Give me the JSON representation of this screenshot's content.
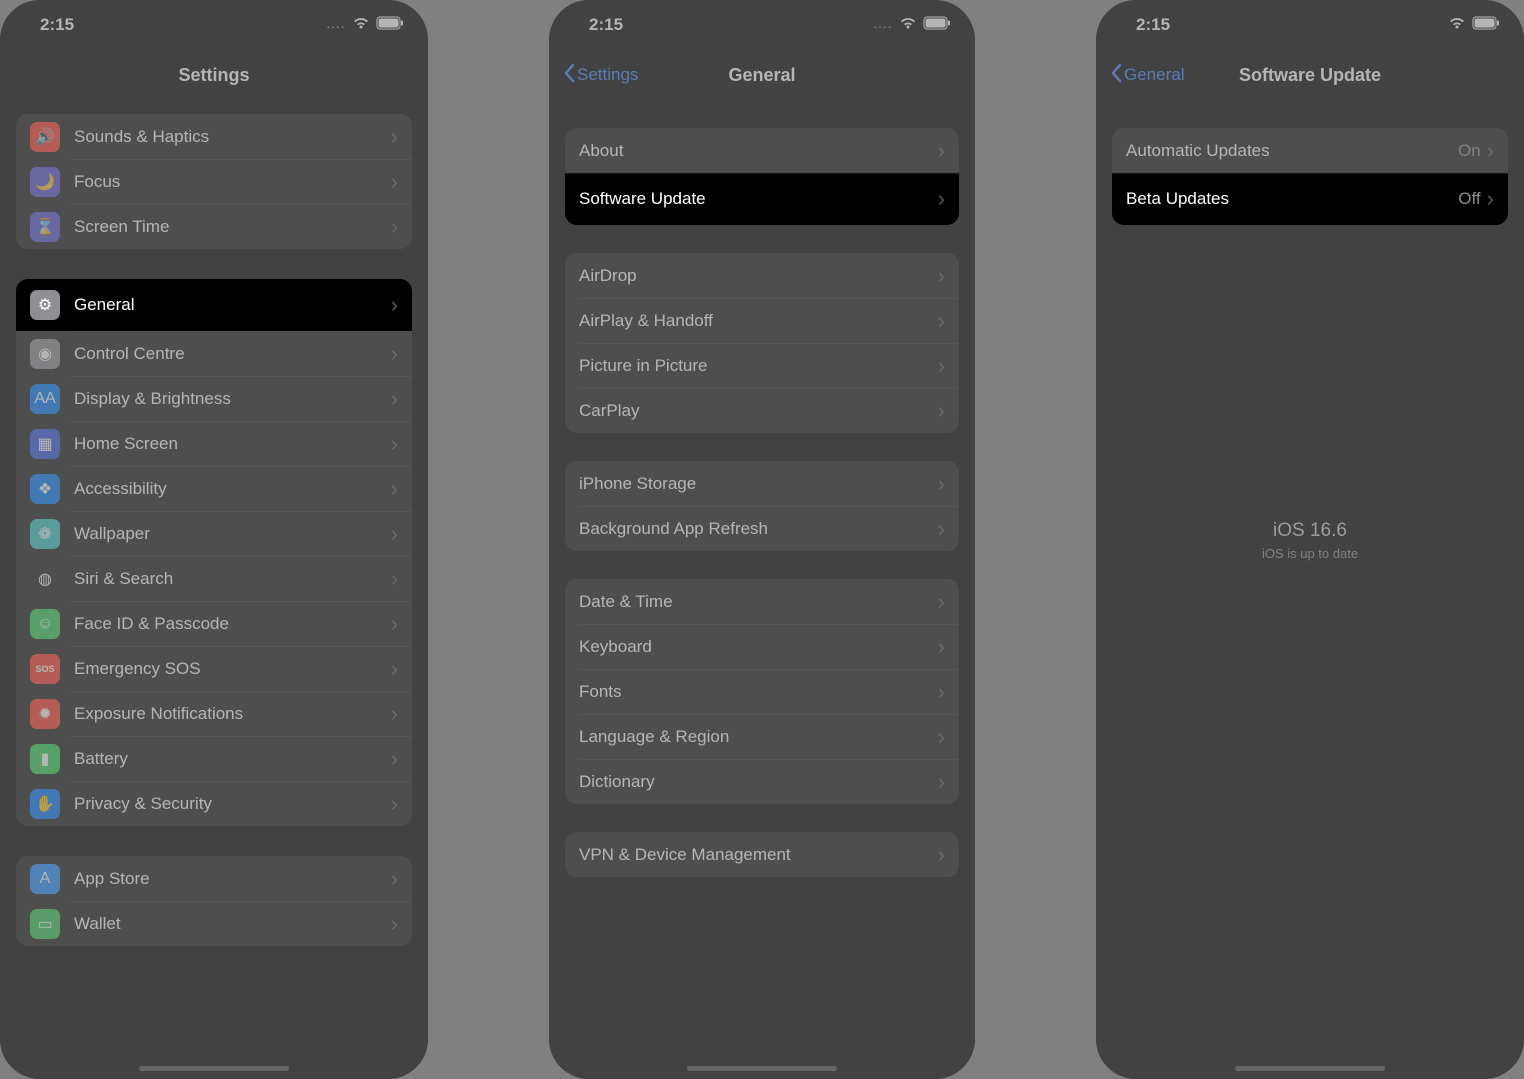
{
  "status": {
    "time": "2:15",
    "dots": "...."
  },
  "screen1": {
    "title": "Settings",
    "group1": [
      {
        "icon": "sounds-icon",
        "bg": "#ff3b30",
        "glyph": "🔊",
        "label": "Sounds & Haptics"
      },
      {
        "icon": "focus-icon",
        "bg": "#5856d6",
        "glyph": "🌙",
        "label": "Focus"
      },
      {
        "icon": "screentime-icon",
        "bg": "#5856d6",
        "glyph": "⌛",
        "label": "Screen Time"
      }
    ],
    "group2": [
      {
        "icon": "general-icon",
        "bg": "#8e8e93",
        "glyph": "⚙",
        "label": "General",
        "hl": true
      },
      {
        "icon": "control-centre-icon",
        "bg": "#8e8e93",
        "glyph": "◉",
        "label": "Control Centre"
      },
      {
        "icon": "display-icon",
        "bg": "#007aff",
        "glyph": "AA",
        "label": "Display & Brightness"
      },
      {
        "icon": "home-screen-icon",
        "bg": "#3355dd",
        "glyph": "▦",
        "label": "Home Screen"
      },
      {
        "icon": "accessibility-icon",
        "bg": "#007aff",
        "glyph": "❖",
        "label": "Accessibility"
      },
      {
        "icon": "wallpaper-icon",
        "bg": "#34c7c2",
        "glyph": "❁",
        "label": "Wallpaper"
      },
      {
        "icon": "siri-icon",
        "bg": "#1c1c1e",
        "glyph": "◍",
        "label": "Siri & Search"
      },
      {
        "icon": "faceid-icon",
        "bg": "#30d158",
        "glyph": "☺",
        "label": "Face ID & Passcode"
      },
      {
        "icon": "sos-icon",
        "bg": "#ff3b30",
        "glyph": "SOS",
        "label": "Emergency SOS"
      },
      {
        "icon": "exposure-icon",
        "bg": "#ff3b30",
        "glyph": "✹",
        "label": "Exposure Notifications"
      },
      {
        "icon": "battery-icon",
        "bg": "#30d158",
        "glyph": "▮",
        "label": "Battery"
      },
      {
        "icon": "privacy-icon",
        "bg": "#007aff",
        "glyph": "✋",
        "label": "Privacy & Security"
      }
    ],
    "group3": [
      {
        "icon": "appstore-icon",
        "bg": "#1e90ff",
        "glyph": "A",
        "label": "App Store"
      },
      {
        "icon": "wallet-icon",
        "bg": "#34c759",
        "glyph": "▭",
        "label": "Wallet"
      }
    ]
  },
  "screen2": {
    "back": "Settings",
    "title": "General",
    "group1": [
      {
        "label": "About"
      },
      {
        "label": "Software Update",
        "hl": true
      }
    ],
    "group2": [
      {
        "label": "AirDrop"
      },
      {
        "label": "AirPlay & Handoff"
      },
      {
        "label": "Picture in Picture"
      },
      {
        "label": "CarPlay"
      }
    ],
    "group3": [
      {
        "label": "iPhone Storage"
      },
      {
        "label": "Background App Refresh"
      }
    ],
    "group4": [
      {
        "label": "Date & Time"
      },
      {
        "label": "Keyboard"
      },
      {
        "label": "Fonts"
      },
      {
        "label": "Language & Region"
      },
      {
        "label": "Dictionary"
      }
    ],
    "group5": [
      {
        "label": "VPN & Device Management"
      }
    ]
  },
  "screen3": {
    "back": "General",
    "title": "Software Update",
    "group1": [
      {
        "label": "Automatic Updates",
        "value": "On"
      },
      {
        "label": "Beta Updates",
        "value": "Off",
        "hl": true
      }
    ],
    "status_title": "iOS 16.6",
    "status_sub": "iOS is up to date"
  }
}
